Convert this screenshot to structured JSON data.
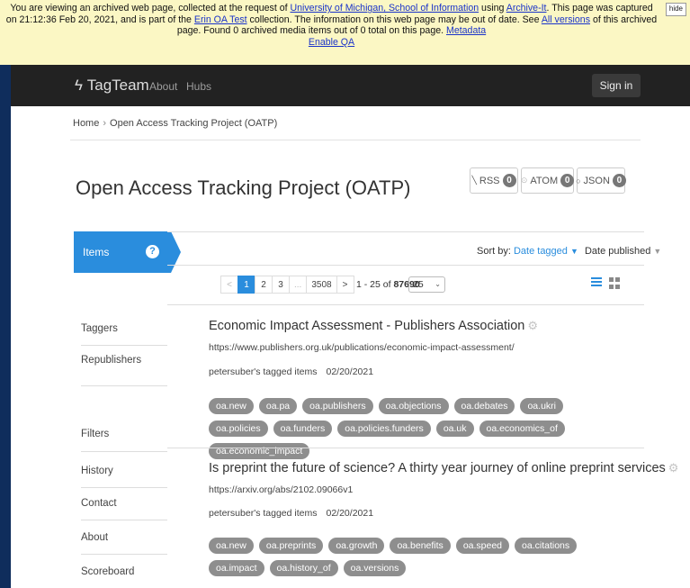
{
  "banner": {
    "t1": "You are viewing an archived web page, collected at the request of ",
    "org_link": "University of Michigan, School of Information",
    "t2": " using ",
    "archive_link": "Archive-It",
    "t3": ". This page was captured on 21:12:36 Feb 20, 2021, and is part of the ",
    "collection_link": "Erin OA Test",
    "t4": " collection. The information on this web page may be out of date. See ",
    "versions_link": "All versions",
    "t5": " of this archived page. Found 0 archived media items out of 0 total on this page. ",
    "metadata_link": "Metadata",
    "qa_link": "Enable QA",
    "hide_label": "hide"
  },
  "nav": {
    "brand": "TagTeam",
    "links": [
      "About",
      "Hubs"
    ],
    "signin": "Sign in"
  },
  "breadcrumb": [
    "Home",
    "Open Access Tracking Project (OATP)"
  ],
  "hub": {
    "title": "Open Access Tracking Project (OATP)",
    "feeds": [
      {
        "icon": "rss-icon",
        "label": "RSS",
        "count": "0"
      },
      {
        "icon": "atom-icon",
        "label": "ATOM",
        "count": "0"
      },
      {
        "icon": "json-icon",
        "label": "JSON",
        "count": "0"
      }
    ]
  },
  "sidebar": {
    "items_label": "Items",
    "help": "?",
    "entries": [
      "Taggers",
      "Republishers",
      "Filters",
      "History",
      "Contact",
      "About",
      "Scoreboard"
    ]
  },
  "sort": {
    "label": "Sort by:",
    "active": "Date tagged",
    "other": "Date published"
  },
  "pagination": {
    "prev": "<",
    "pages": [
      "1",
      "2",
      "3",
      "...",
      "3508"
    ],
    "next": ">",
    "range": "1 - 25",
    "of": "of",
    "total": "87690",
    "per_page": "25"
  },
  "items": [
    {
      "title": "Economic Impact Assessment - Publishers Association",
      "url": "https://www.publishers.org.uk/publications/economic-impact-assessment/",
      "tagger": "petersuber's tagged items",
      "date": "02/20/2021",
      "tags": [
        "oa.new",
        "oa.pa",
        "oa.publishers",
        "oa.objections",
        "oa.debates",
        "oa.ukri",
        "oa.policies",
        "oa.funders",
        "oa.policies.funders",
        "oa.uk",
        "oa.economics_of",
        "oa.economic_impact"
      ]
    },
    {
      "title": "Is preprint the future of science? A thirty year journey of online preprint services",
      "url": "https://arxiv.org/abs/2102.09066v1",
      "tagger": "petersuber's tagged items",
      "date": "02/20/2021",
      "tags": [
        "oa.new",
        "oa.preprints",
        "oa.growth",
        "oa.benefits",
        "oa.speed",
        "oa.citations",
        "oa.impact",
        "oa.history_of",
        "oa.versions"
      ]
    }
  ],
  "colors": {
    "accent": "#2a8ddd",
    "navbar": "#222222",
    "banner": "#fbf7c4",
    "tag": "#8e8e8e",
    "outer": "#0f2d5c"
  }
}
